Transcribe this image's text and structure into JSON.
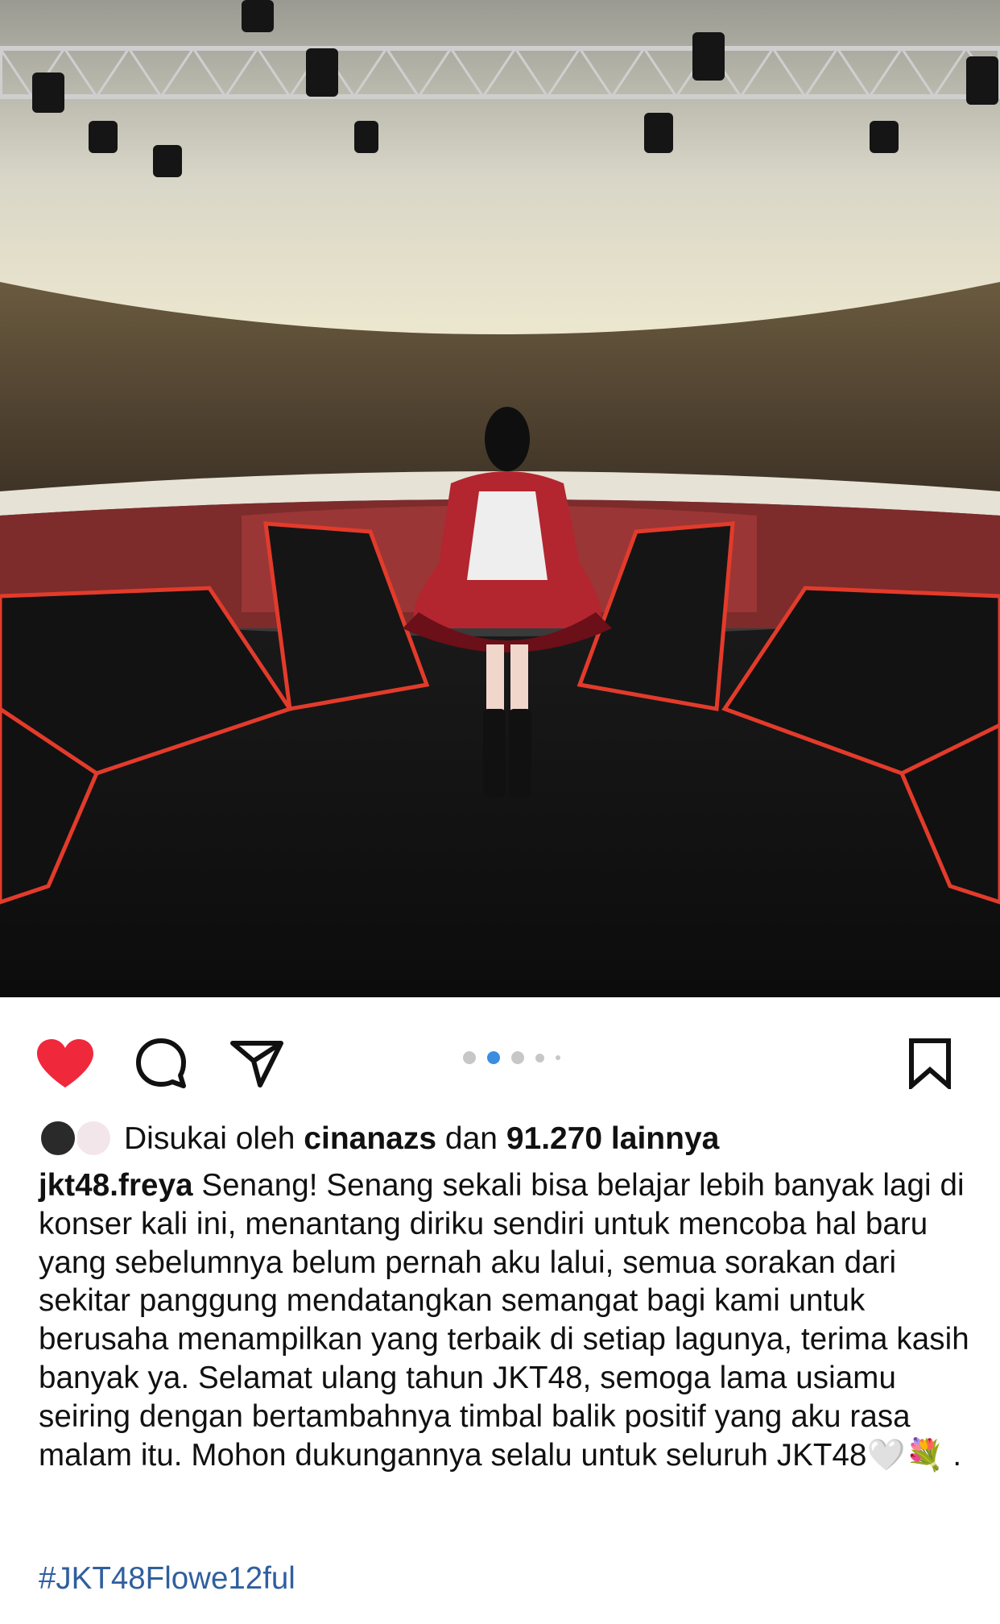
{
  "post": {
    "carousel": {
      "total": 5,
      "active_index": 1
    },
    "likes": {
      "prefix": "Disukai oleh",
      "user": "cinanazs",
      "middle": "dan",
      "count": "91.270 lainnya"
    },
    "caption": {
      "username": "jkt48.freya",
      "text": "Senang! Senang sekali bisa belajar lebih banyak lagi di konser kali ini, menantang diriku sendiri untuk mencoba hal baru yang sebelumnya belum pernah aku lalui, semua sorakan dari sekitar panggung mendatangkan semangat bagi kami untuk berusaha menampilkan yang terbaik di setiap lagunya, terima kasih banyak ya. Selamat ulang tahun JKT48, semoga lama usiamu seiring dengan bertambahnya timbal balik positif yang aku rasa malam itu. Mohon dukungannya selalu untuk seluruh JKT48",
      "emoji": "🤍💐",
      "end": "."
    },
    "hashtag": "#JKT48Flowe12ful"
  },
  "icons": {
    "like": "heart-filled-icon",
    "comment": "comment-bubble-icon",
    "share": "paper-plane-icon",
    "save": "bookmark-icon"
  },
  "colors": {
    "like": "#f0283c",
    "active_dot": "#3b8de0",
    "hashtag": "#2f5f9e"
  }
}
